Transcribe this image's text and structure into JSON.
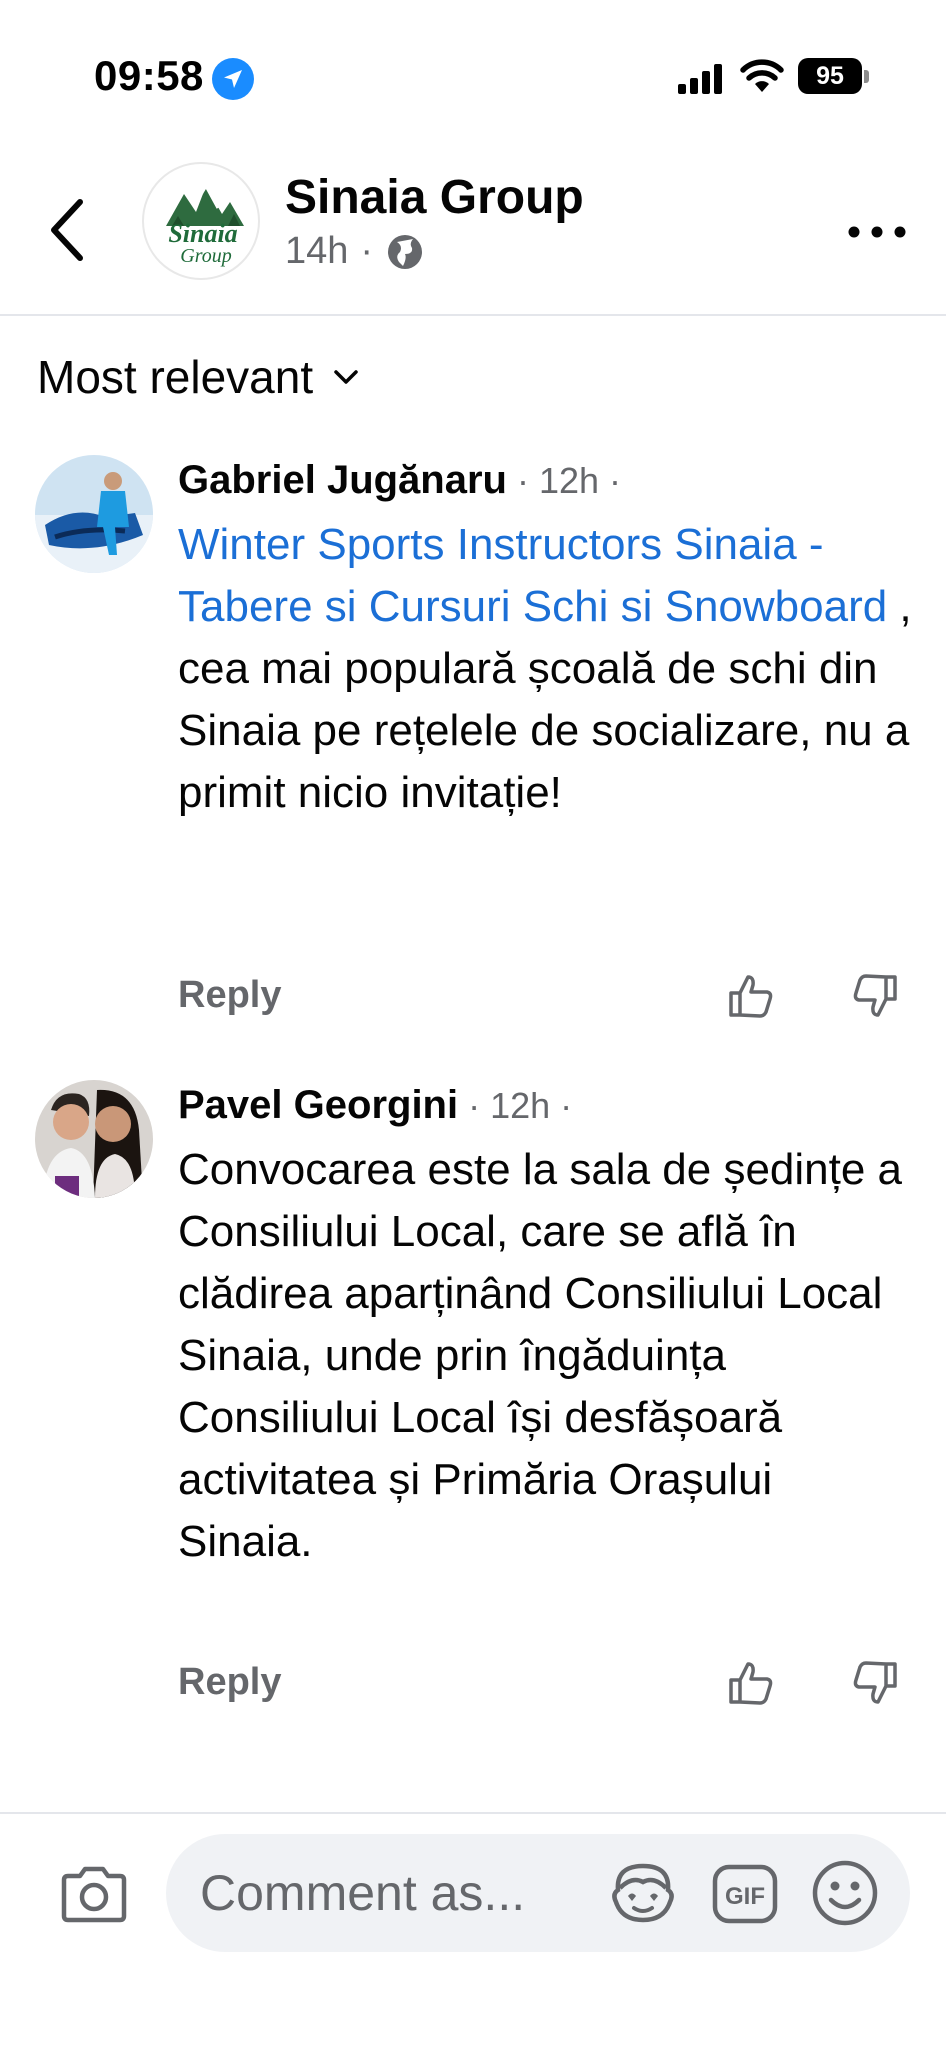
{
  "status_bar": {
    "time": "09:58",
    "battery": "95"
  },
  "header": {
    "group_name": "Sinaia Group",
    "logo_text_top": "Sinaia",
    "logo_text_bottom": "Group",
    "post_age": "14h",
    "separator": "·"
  },
  "sort": {
    "label": "Most relevant"
  },
  "comments": [
    {
      "author": "Gabriel Jugănaru",
      "time": " · 12h · ",
      "mention": "Winter Sports Instructors Sinaia - Tabere si Cursuri Schi si Snowboard",
      "text": " , cea mai populară școală de schi din Sinaia pe rețelele de socializare, nu a primit nicio invitație!",
      "reply_label": "Reply"
    },
    {
      "author": "Pavel Georgini",
      "time": " · 12h · ",
      "text": "Convocarea este la sala de ședințe a Consiliului Local, care se află în clădirea aparținând Consiliului Local Sinaia, unde prin îngăduința Consiliului Local își desfășoară activitatea și Primăria Orașului Sinaia.",
      "reply_label": "Reply"
    }
  ],
  "composer": {
    "placeholder": "Comment as...",
    "gif_label": "GIF"
  },
  "colors": {
    "mention": "#1b6fd6",
    "secondary_text": "#65676b",
    "location_blue": "#1a8cff",
    "logo_green": "#1f6b3a"
  },
  "icons": [
    "location-arrow-icon",
    "signal-icon",
    "wifi-icon",
    "back-chevron-icon",
    "globe-icon",
    "more-dots-icon",
    "chevron-down-icon",
    "thumbs-up-icon",
    "thumbs-down-icon",
    "camera-icon",
    "avatar-sticker-icon",
    "gif-icon",
    "smiley-icon"
  ]
}
